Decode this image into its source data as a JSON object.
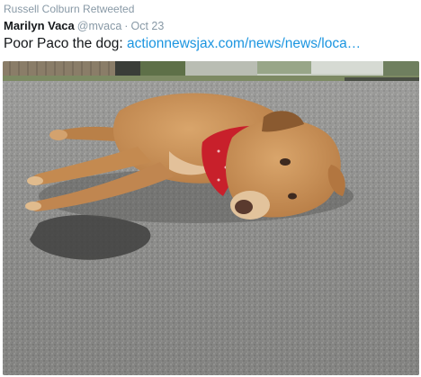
{
  "retweet": {
    "text": "Russell Colburn Retweeted"
  },
  "tweet": {
    "display_name": "Marilyn Vaca",
    "handle": "@mvaca",
    "separator": "·",
    "date": "Oct 23",
    "text": "Poor Paco the dog: ",
    "link_text": "actionnewsjax.com/news/news/loca…"
  },
  "colors": {
    "link": "#1b95e0",
    "meta_gray": "#8899a6",
    "text": "#14171a",
    "bandana_red": "#c8202b",
    "fur_tan": "#c99058"
  },
  "media": {
    "subject_icon": "dog-photo-icon"
  }
}
